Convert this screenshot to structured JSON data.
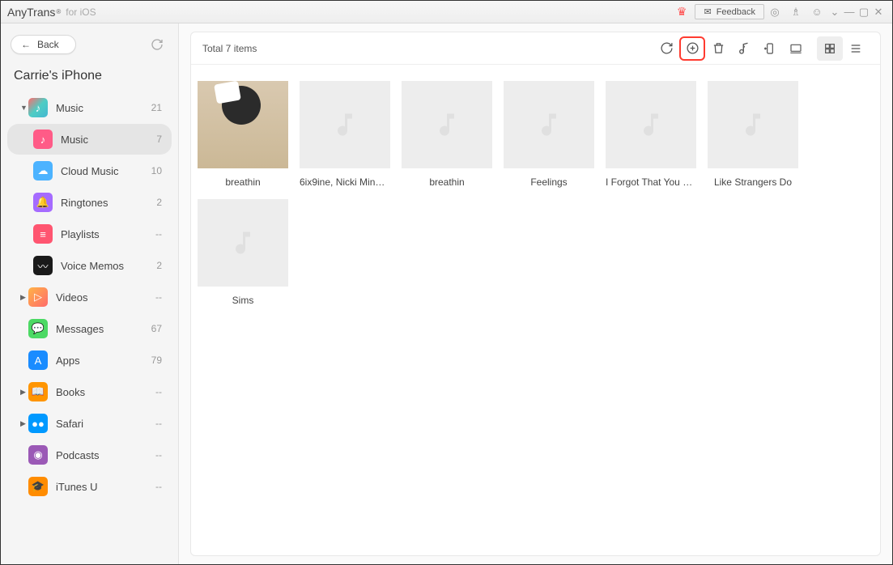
{
  "titlebar": {
    "app_name": "AnyTrans",
    "app_suffix": "for iOS",
    "feedback_label": "Feedback"
  },
  "sidebar": {
    "back_label": "Back",
    "device_name": "Carrie's iPhone",
    "items": [
      {
        "label": "Music",
        "count": "21",
        "expanded": true
      },
      {
        "label": "Music",
        "count": "7",
        "sub": true,
        "selected": true
      },
      {
        "label": "Cloud Music",
        "count": "10",
        "sub": true
      },
      {
        "label": "Ringtones",
        "count": "2",
        "sub": true
      },
      {
        "label": "Playlists",
        "count": "--",
        "sub": true
      },
      {
        "label": "Voice Memos",
        "count": "2",
        "sub": true
      },
      {
        "label": "Videos",
        "count": "--",
        "expandable": true
      },
      {
        "label": "Messages",
        "count": "67"
      },
      {
        "label": "Apps",
        "count": "79"
      },
      {
        "label": "Books",
        "count": "--",
        "expandable": true
      },
      {
        "label": "Safari",
        "count": "--",
        "expandable": true
      },
      {
        "label": "Podcasts",
        "count": "--"
      },
      {
        "label": "iTunes U",
        "count": "--"
      }
    ]
  },
  "main": {
    "total_label": "Total 7 items",
    "tiles": [
      {
        "label": "breathin",
        "has_art": true
      },
      {
        "label": "6ix9ine, Nicki Mina…"
      },
      {
        "label": "breathin"
      },
      {
        "label": "Feelings"
      },
      {
        "label": "I Forgot That You E…"
      },
      {
        "label": "Like Strangers Do"
      },
      {
        "label": "Sims"
      }
    ]
  }
}
